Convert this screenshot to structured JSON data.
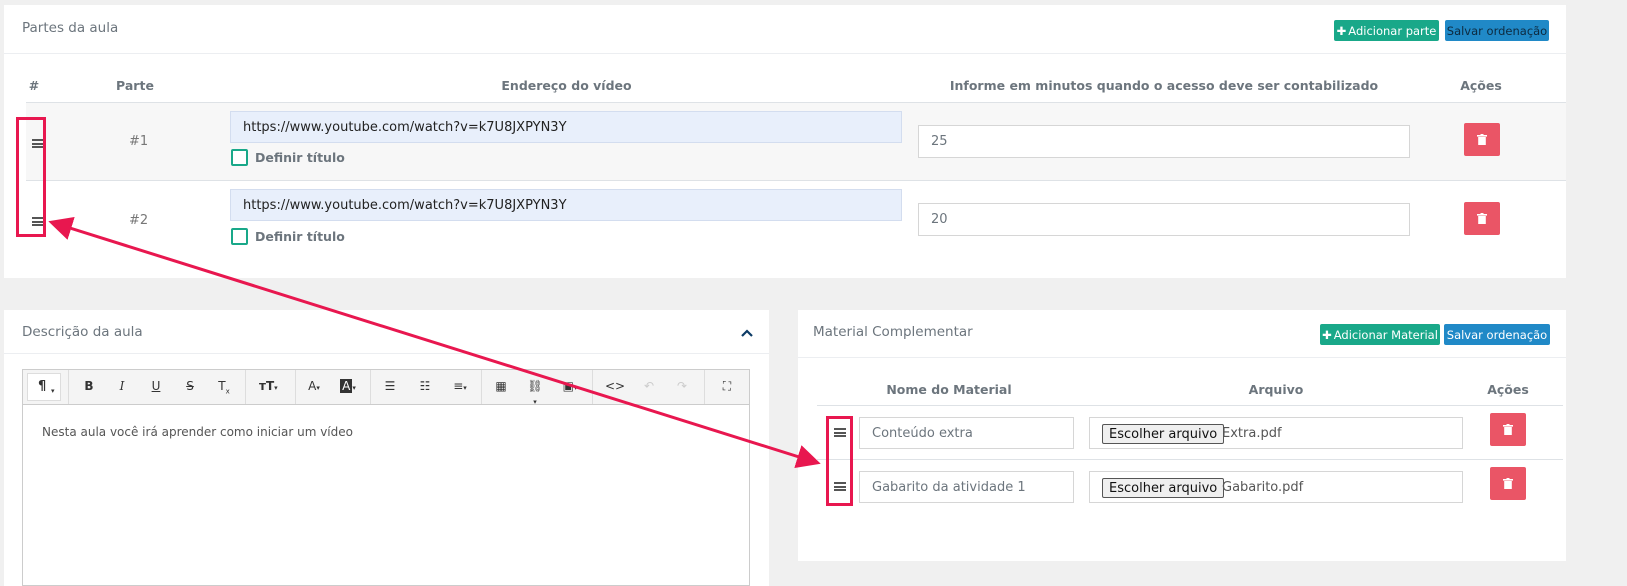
{
  "parts": {
    "title": "Partes da aula",
    "add_button": "Adicionar parte",
    "save_order_button": "Salvar ordenação",
    "headers": [
      "#",
      "Parte",
      "Endereço do vídeo",
      "Informe em minutos quando o acesso deve ser contabilizado",
      "Ações"
    ],
    "rows": [
      {
        "number": "#1",
        "url": "https://www.youtube.com/watch?v=k7U8JXPYN3Y",
        "title_checkbox_label": "Definir título",
        "minutes": "25"
      },
      {
        "number": "#2",
        "url": "https://www.youtube.com/watch?v=k7U8JXPYN3Y",
        "title_checkbox_label": "Definir título",
        "minutes": "20"
      }
    ]
  },
  "description": {
    "title": "Descrição da aula",
    "editor_text": "Nesta aula você irá aprender como iniciar um vídeo",
    "toolbar_icons": [
      "paragraph-icon",
      "bold-icon",
      "italic-icon",
      "underline-icon",
      "strikethrough-icon",
      "clear-format-icon",
      "font-size-icon",
      "font-color-icon",
      "background-color-icon",
      "unordered-list-icon",
      "ordered-list-icon",
      "align-icon",
      "table-icon",
      "link-icon",
      "image-icon",
      "code-view-icon",
      "undo-icon",
      "redo-icon",
      "fullscreen-icon"
    ]
  },
  "material": {
    "title": "Material Complementar",
    "add_button": "Adicionar Material",
    "save_order_button": "Salvar ordenação",
    "headers": [
      "Nome do Material",
      "Arquivo",
      "Ações"
    ],
    "rows": [
      {
        "name": "Conteúdo extra",
        "choose_file_label": "Escolher arquivo",
        "file_name": "Extra.pdf"
      },
      {
        "name": "Gabarito da atividade 1",
        "choose_file_label": "Escolher arquivo",
        "file_name": "Gabarito.pdf"
      }
    ]
  },
  "colors": {
    "green": "#19a889",
    "blue": "#2089c7",
    "danger": "#ea5566",
    "annotation": "#e8174f"
  }
}
